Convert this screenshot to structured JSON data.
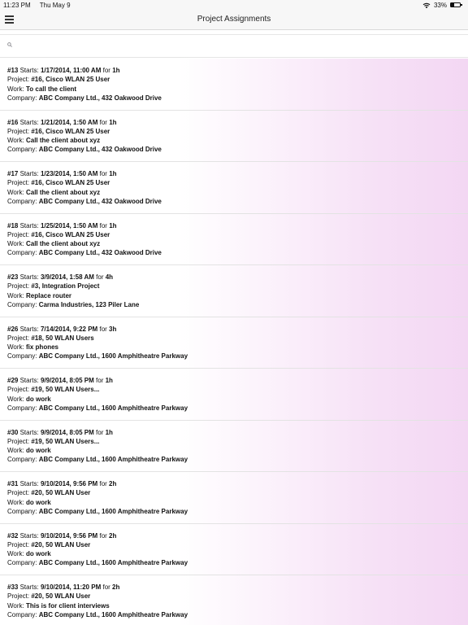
{
  "status_bar": {
    "time": "11:23 PM",
    "date": "Thu May 9",
    "battery": "33%",
    "icons": [
      "wifi-icon",
      "battery-icon"
    ]
  },
  "nav": {
    "title": "Project Assignments",
    "menu_icon": "hamburger-menu-icon"
  },
  "search": {
    "placeholder": "",
    "value": "",
    "icon": "search-icon"
  },
  "labels": {
    "starts": "Starts:",
    "for": "for",
    "project": "Project:",
    "work": "Work:",
    "company": "Company:"
  },
  "assignments": [
    {
      "id": "#13",
      "starts": "1/17/2014, 11:00 AM",
      "duration": "1h",
      "project": "#16, Cisco WLAN 25 User",
      "work": "To call the client",
      "company": "ABC Company Ltd., 432 Oakwood Drive"
    },
    {
      "id": "#16",
      "starts": "1/21/2014, 1:50 AM",
      "duration": "1h",
      "project": "#16, Cisco WLAN 25 User",
      "work": "Call the client about xyz",
      "company": "ABC Company Ltd., 432 Oakwood Drive"
    },
    {
      "id": "#17",
      "starts": "1/23/2014, 1:50 AM",
      "duration": "1h",
      "project": "#16, Cisco WLAN 25 User",
      "work": "Call the client about xyz",
      "company": "ABC Company Ltd., 432 Oakwood Drive"
    },
    {
      "id": "#18",
      "starts": "1/25/2014, 1:50 AM",
      "duration": "1h",
      "project": "#16, Cisco WLAN 25 User",
      "work": "Call the client about xyz",
      "company": "ABC Company Ltd., 432 Oakwood Drive"
    },
    {
      "id": "#23",
      "starts": "3/9/2014, 1:58 AM",
      "duration": "4h",
      "project": "#3, Integration Project",
      "work": "Replace router",
      "company": "Carma Industries, 123 Piler Lane"
    },
    {
      "id": "#26",
      "starts": "7/14/2014, 9:22 PM",
      "duration": "3h",
      "project": "#18, 50 WLAN Users",
      "work": "fix phones",
      "company": "ABC Company Ltd., 1600 Amphitheatre Parkway"
    },
    {
      "id": "#29",
      "starts": "9/9/2014, 8:05 PM",
      "duration": "1h",
      "project": "#19, 50 WLAN Users...",
      "work": "do work",
      "company": "ABC Company Ltd., 1600 Amphitheatre Parkway"
    },
    {
      "id": "#30",
      "starts": "9/9/2014, 8:05 PM",
      "duration": "1h",
      "project": "#19, 50 WLAN Users...",
      "work": "do work",
      "company": "ABC Company Ltd., 1600 Amphitheatre Parkway"
    },
    {
      "id": "#31",
      "starts": "9/10/2014, 9:56 PM",
      "duration": "2h",
      "project": "#20, 50 WLAN User",
      "work": "do work",
      "company": "ABC Company Ltd., 1600 Amphitheatre Parkway"
    },
    {
      "id": "#32",
      "starts": "9/10/2014, 9:56 PM",
      "duration": "2h",
      "project": "#20, 50 WLAN User",
      "work": "do work",
      "company": "ABC Company Ltd., 1600 Amphitheatre Parkway"
    },
    {
      "id": "#33",
      "starts": "9/10/2014, 11:20 PM",
      "duration": "2h",
      "project": "#20, 50 WLAN User",
      "work": "This is for client interviews",
      "company": "ABC Company Ltd., 1600 Amphitheatre Parkway"
    }
  ]
}
